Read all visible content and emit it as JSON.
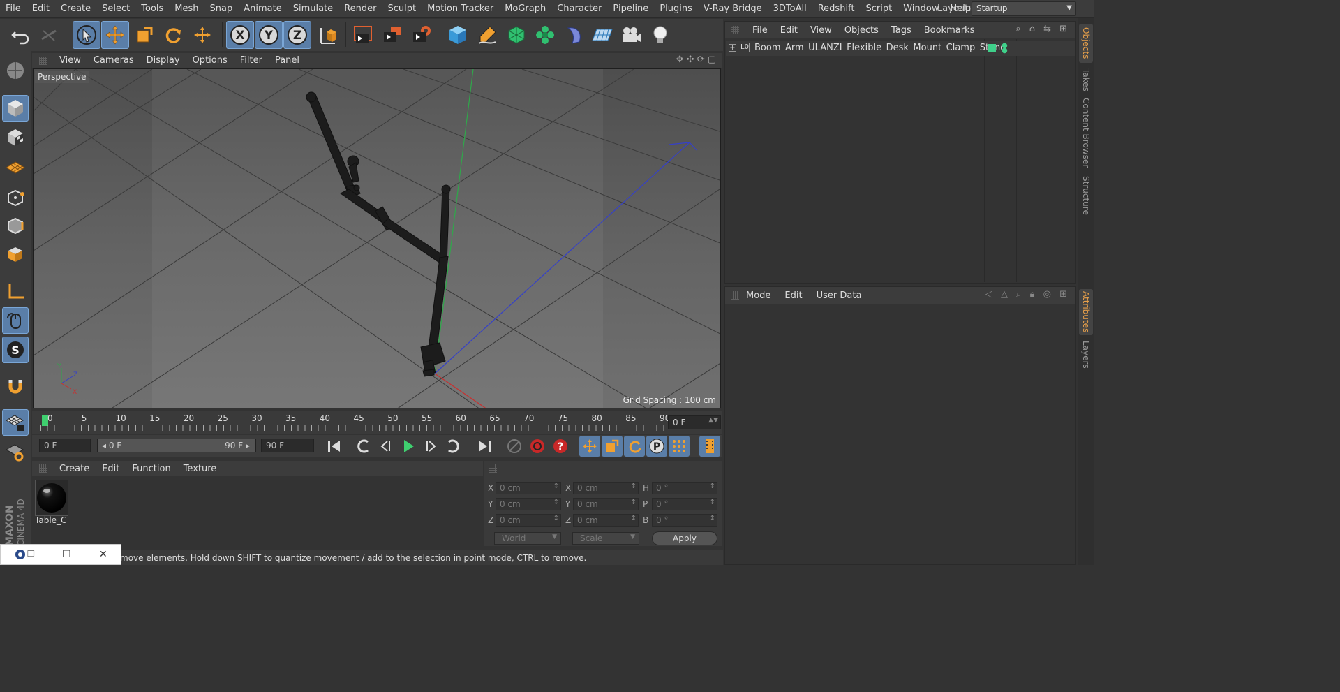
{
  "menubar": {
    "items": [
      "File",
      "Edit",
      "Create",
      "Select",
      "Tools",
      "Mesh",
      "Snap",
      "Animate",
      "Simulate",
      "Render",
      "Sculpt",
      "Motion Tracker",
      "MoGraph",
      "Character",
      "Pipeline",
      "Plugins",
      "V-Ray Bridge",
      "3DToAll",
      "Redshift",
      "Script",
      "Window",
      "Help"
    ],
    "layout_label": "Layout:",
    "layout_value": "Startup"
  },
  "toolbar": {
    "icons": [
      "undo-icon",
      "redo-icon",
      "live-selection-icon",
      "move-icon",
      "scale-icon",
      "rotate-icon",
      "transform-icon",
      "x-axis-lock-icon",
      "y-axis-lock-icon",
      "z-axis-lock-icon",
      "coordinate-system-icon",
      "render-view-icon",
      "render-picture-viewer-icon",
      "render-settings-icon",
      "cube-icon",
      "pen-icon",
      "subdivision-icon",
      "cloner-icon",
      "deformer-icon",
      "floor-icon",
      "camera-icon",
      "light-icon"
    ]
  },
  "viewport": {
    "menu": [
      "View",
      "Cameras",
      "Display",
      "Options",
      "Filter",
      "Panel"
    ],
    "label": "Perspective",
    "grid_spacing": "Grid Spacing : 100 cm",
    "axis": {
      "x_color": "#c03030",
      "y_color": "#30a030",
      "z_color": "#3040c0"
    }
  },
  "timeline": {
    "ticks": [
      "0",
      "5",
      "10",
      "15",
      "20",
      "25",
      "30",
      "35",
      "40",
      "45",
      "50",
      "55",
      "60",
      "65",
      "70",
      "75",
      "80",
      "85",
      "90"
    ],
    "current_frame": "0 F",
    "start_field": "0 F",
    "range_start": "0 F",
    "range_end": "90 F",
    "end_field": "90 F",
    "playhead_color": "#3fcf6f"
  },
  "material_manager": {
    "menu": [
      "Create",
      "Edit",
      "Function",
      "Texture"
    ],
    "materials": [
      {
        "name": "Table_C"
      }
    ]
  },
  "coordinates": {
    "headers": [
      "--",
      "--",
      "--"
    ],
    "position": [
      {
        "axis": "X",
        "value": "0 cm"
      },
      {
        "axis": "Y",
        "value": "0 cm"
      },
      {
        "axis": "Z",
        "value": "0 cm"
      }
    ],
    "size": [
      {
        "axis": "X",
        "value": "0 cm"
      },
      {
        "axis": "Y",
        "value": "0 cm"
      },
      {
        "axis": "Z",
        "value": "0 cm"
      }
    ],
    "rotation": [
      {
        "axis": "H",
        "value": "0 °"
      },
      {
        "axis": "P",
        "value": "0 °"
      },
      {
        "axis": "B",
        "value": "0 °"
      }
    ],
    "world_label": "World",
    "scale_label": "Scale",
    "apply_label": "Apply"
  },
  "status": {
    "text": "move elements. Hold down SHIFT to quantize movement / add to the selection in point mode, CTRL to remove."
  },
  "object_manager": {
    "menu": [
      "File",
      "Edit",
      "View",
      "Objects",
      "Tags",
      "Bookmarks"
    ],
    "objects": [
      {
        "name": "Boom_Arm_ULANZI_Flexible_Desk_Mount_Clamp_Stand",
        "layer_color": "#3fd08a"
      }
    ]
  },
  "attribute_manager": {
    "menu": [
      "Mode",
      "Edit",
      "User Data"
    ]
  },
  "right_tabs": [
    "Objects",
    "Takes",
    "Content Browser",
    "Structure",
    "Attributes",
    "Layers"
  ],
  "brand": {
    "line1": "MAXON",
    "line2": "CINEMA 4D"
  }
}
